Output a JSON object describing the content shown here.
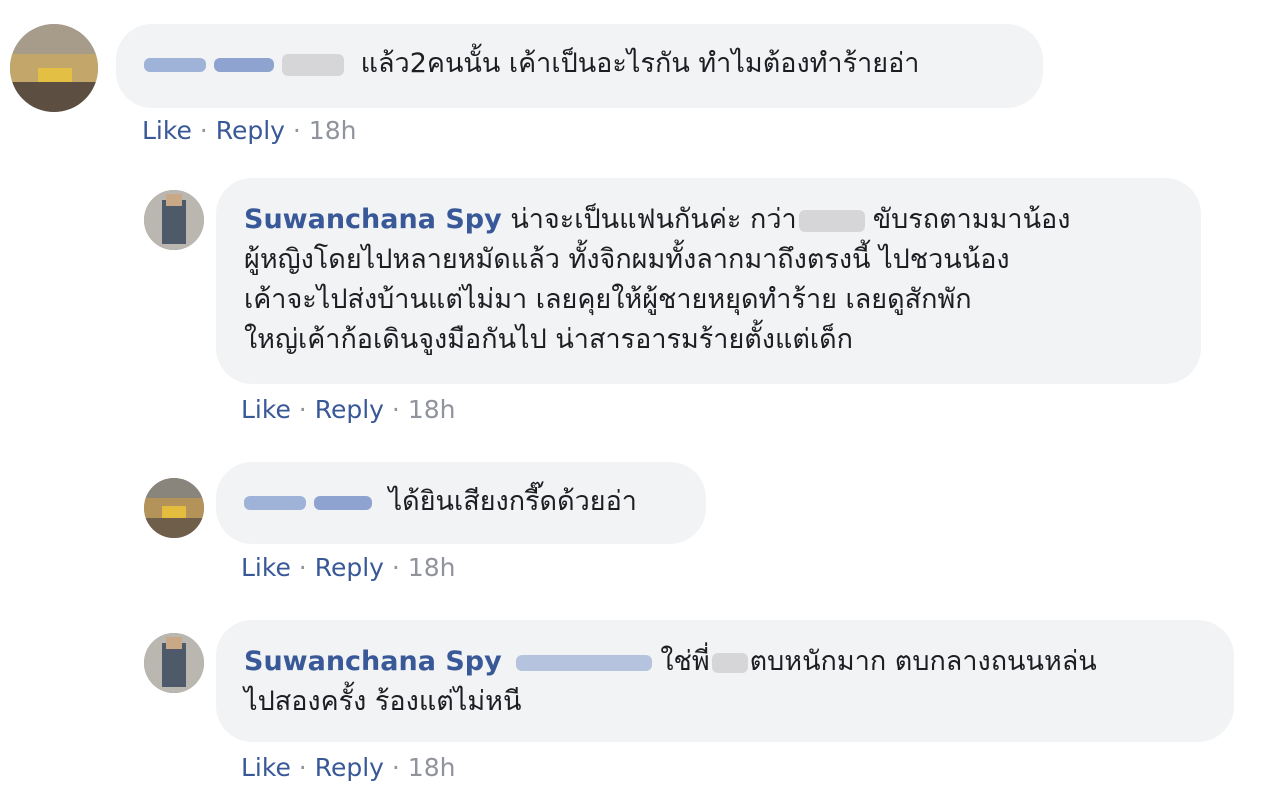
{
  "comments": [
    {
      "id": "c1",
      "author_hidden": true,
      "text": "แล้ว2คนนั้น เค้าเป็นอะไรกัน ทำไมต้องทำร้ายอ่า",
      "actions": {
        "like": "Like",
        "reply": "Reply",
        "time": "18h",
        "dot": "·"
      }
    },
    {
      "id": "c2",
      "author": "Suwanchana Spy",
      "lines": [
        "น่าจะเป็นแฟนกันค่ะ กว่า",
        "ขับรถตามมาน้อง",
        "ผู้หญิงโดยไปหลายหมัดแล้ว ทั้งจิกผมทั้งลากมาถึงตรงนี้ ไปชวนน้อง",
        "เค้าจะไปส่งบ้านแต่ไม่มา เลยคุยให้ผู้ชายหยุดทำร้าย เลยดูสักพัก",
        "ใหญ่เค้าก้อเดินจูงมือกันไป น่าสารอารมร้ายตั้งแต่เด็ก"
      ],
      "actions": {
        "like": "Like",
        "reply": "Reply",
        "time": "18h",
        "dot": "·"
      }
    },
    {
      "id": "c3",
      "author_hidden": true,
      "text": "ได้ยินเสียงกรี๊ดด้วยอ่า",
      "actions": {
        "like": "Like",
        "reply": "Reply",
        "time": "18h",
        "dot": "·"
      }
    },
    {
      "id": "c4",
      "author": "Suwanchana Spy",
      "lines": [
        "ใช่พี่",
        "ตบหนักมาก ตบกลางถนนหล่น",
        "ไปสองครั้ง ร้องแต่ไม่หนี"
      ],
      "actions": {
        "like": "Like",
        "reply": "Reply",
        "time": "18h",
        "dot": "·"
      }
    }
  ]
}
